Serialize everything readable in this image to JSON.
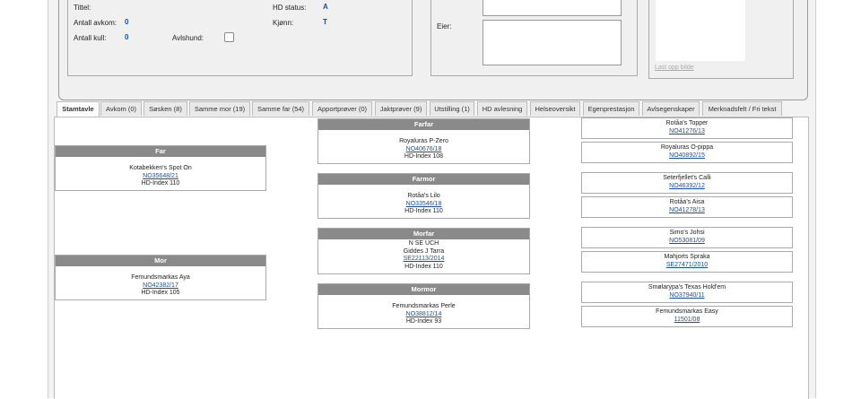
{
  "dog_info": {
    "title_label": "Tittel:",
    "offspring_label": "Antall avkom:",
    "offspring_value": "0",
    "litters_label": "Antall kull:",
    "litters_value": "0",
    "breeding_female_label": "Avlshund:",
    "hd_status_label": "HD status:",
    "hd_status_value": "A",
    "sex_label": "Kjønn:",
    "sex_value": "T",
    "owner_label": "Eier:",
    "upload_label": "Last opp bilde"
  },
  "tabs": [
    {
      "label": "Stamtavle"
    },
    {
      "label": "Avkom (0)"
    },
    {
      "label": "Søsken (8)"
    },
    {
      "label": "Samme mor (19)"
    },
    {
      "label": "Samme far (54)"
    },
    {
      "label": "Apportprøver (0)"
    },
    {
      "label": "Jaktprøver (9)"
    },
    {
      "label": "Utstilling (1)"
    },
    {
      "label": "HD avlesning"
    },
    {
      "label": "Helseoversikt"
    },
    {
      "label": "Egenprestasjon"
    },
    {
      "label": "Avlsegenskaper"
    },
    {
      "label": "Merknadsfelt / Fri tekst"
    }
  ],
  "pedigree": {
    "far": {
      "heading": "Far",
      "name": "Kotabekken's Spot On",
      "reg": "NO35648/21",
      "hd": "HD-Index 110"
    },
    "mor": {
      "heading": "Mor",
      "name": "Femundsmarkas Aya",
      "reg": "NO42382/17",
      "hd": "HD-Index 105"
    },
    "farfar": {
      "heading": "Farfar",
      "name": "Royaluras P-Zero",
      "reg": "NO40676/18",
      "hd": "HD-Index 108"
    },
    "farmor": {
      "heading": "Farmor",
      "name": "Rotåa's Lilo",
      "reg": "NO33546/18",
      "hd": "HD-Index 110"
    },
    "morfar": {
      "heading": "Morfar",
      "name_line1": "N SE UCH",
      "name_line2": "Giddes J Tarra",
      "reg": "SE22113/2014",
      "hd": "HD-Index 110"
    },
    "mormor": {
      "heading": "Mormor",
      "name": "Femundsmarkas Perle",
      "reg": "NO38812/14",
      "hd": "HD-Index 93"
    }
  },
  "great_grandparents": [
    {
      "name": "Rotåa's Topper",
      "reg": "NO41276/13"
    },
    {
      "name": "Royaluras O-pippa",
      "reg": "NO40892/15"
    },
    {
      "name": "Seterfjellet's Calli",
      "reg": "NO46392/12"
    },
    {
      "name": "Rotåa's Aisa",
      "reg": "NO41278/13"
    },
    {
      "name": "Simo's Johsi",
      "reg": "NO53081/09"
    },
    {
      "name": "Mahjorts Spraka",
      "reg": "SE27471/2010"
    },
    {
      "name": "Smølarypa's Texas Hold'em",
      "reg": "NO37940/11"
    },
    {
      "name": "Femundsmarkas Easy",
      "reg": "11501/08"
    }
  ]
}
